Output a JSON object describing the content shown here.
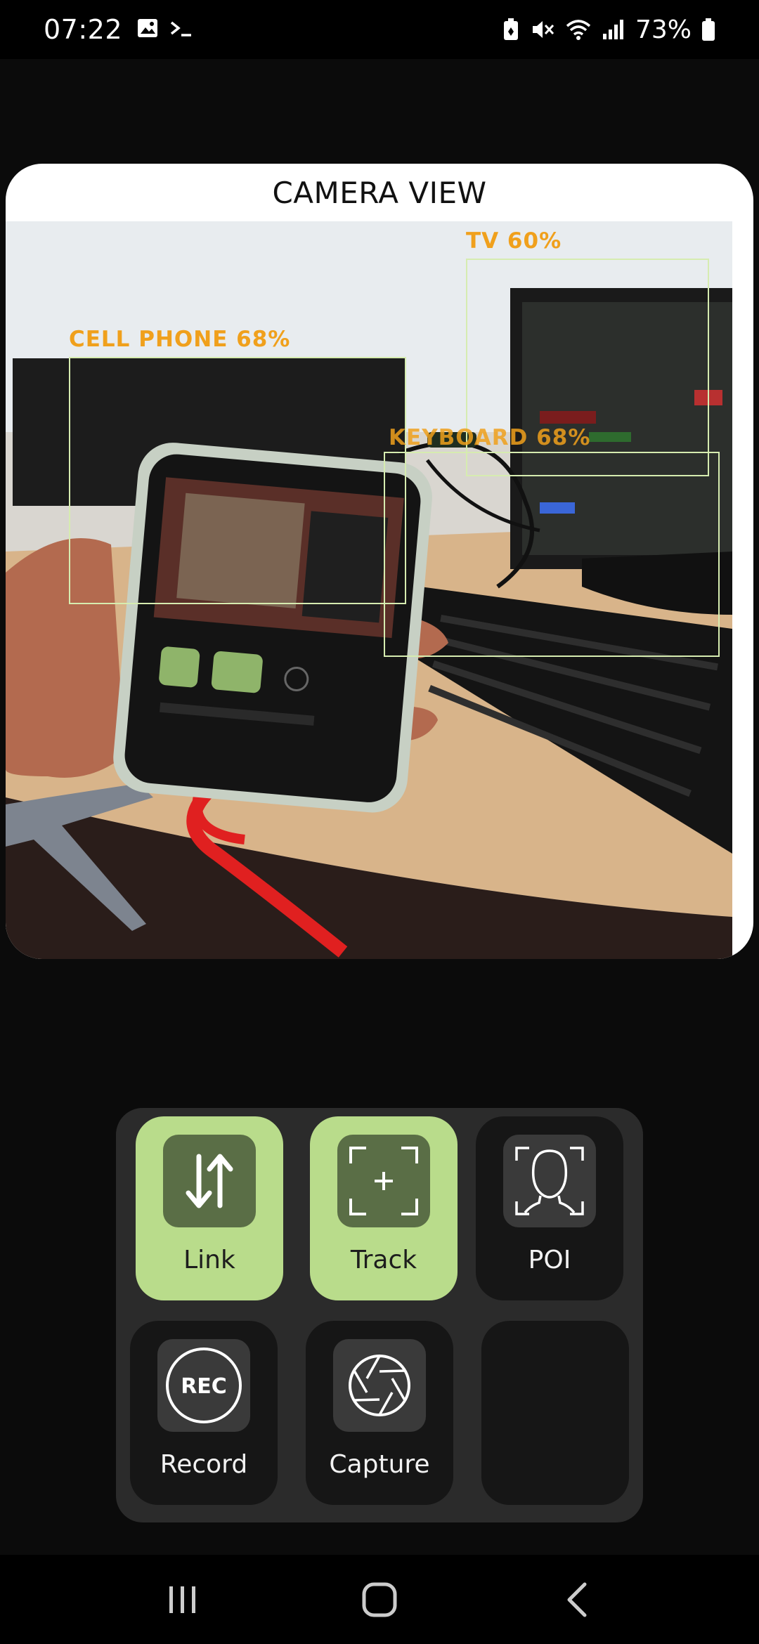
{
  "status_bar": {
    "time": "07:22",
    "battery": "73%",
    "icons": [
      "image-icon",
      "terminal-icon",
      "battery-saver-icon",
      "mute-icon",
      "wifi-icon",
      "signal-icon",
      "battery-icon"
    ]
  },
  "camera": {
    "title": "CAMERA VIEW",
    "detections": [
      {
        "label": "TV 60%"
      },
      {
        "label": "CELL PHONE 68%"
      },
      {
        "label": "KEYBOARD 68%"
      }
    ]
  },
  "controls": {
    "link": {
      "label": "Link",
      "active": true,
      "icon": "link-arrows-icon"
    },
    "track": {
      "label": "Track",
      "active": true,
      "icon": "track-crosshair-icon"
    },
    "poi": {
      "label": "POI",
      "active": false,
      "icon": "face-scan-icon"
    },
    "record": {
      "label": "Record",
      "icon_text": "REC",
      "active": false
    },
    "capture": {
      "label": "Capture",
      "active": false,
      "icon": "aperture-icon"
    },
    "empty_slot": {
      "label": ""
    }
  },
  "nav": {
    "icons": [
      "recents-icon",
      "home-icon",
      "back-icon"
    ]
  },
  "colors": {
    "accent": "#b9dc8b",
    "accent_dark": "#5a6e46",
    "panel": "#2b2b2b",
    "detection_label": "#f0a01c",
    "detection_box": "#d6ecb0"
  }
}
